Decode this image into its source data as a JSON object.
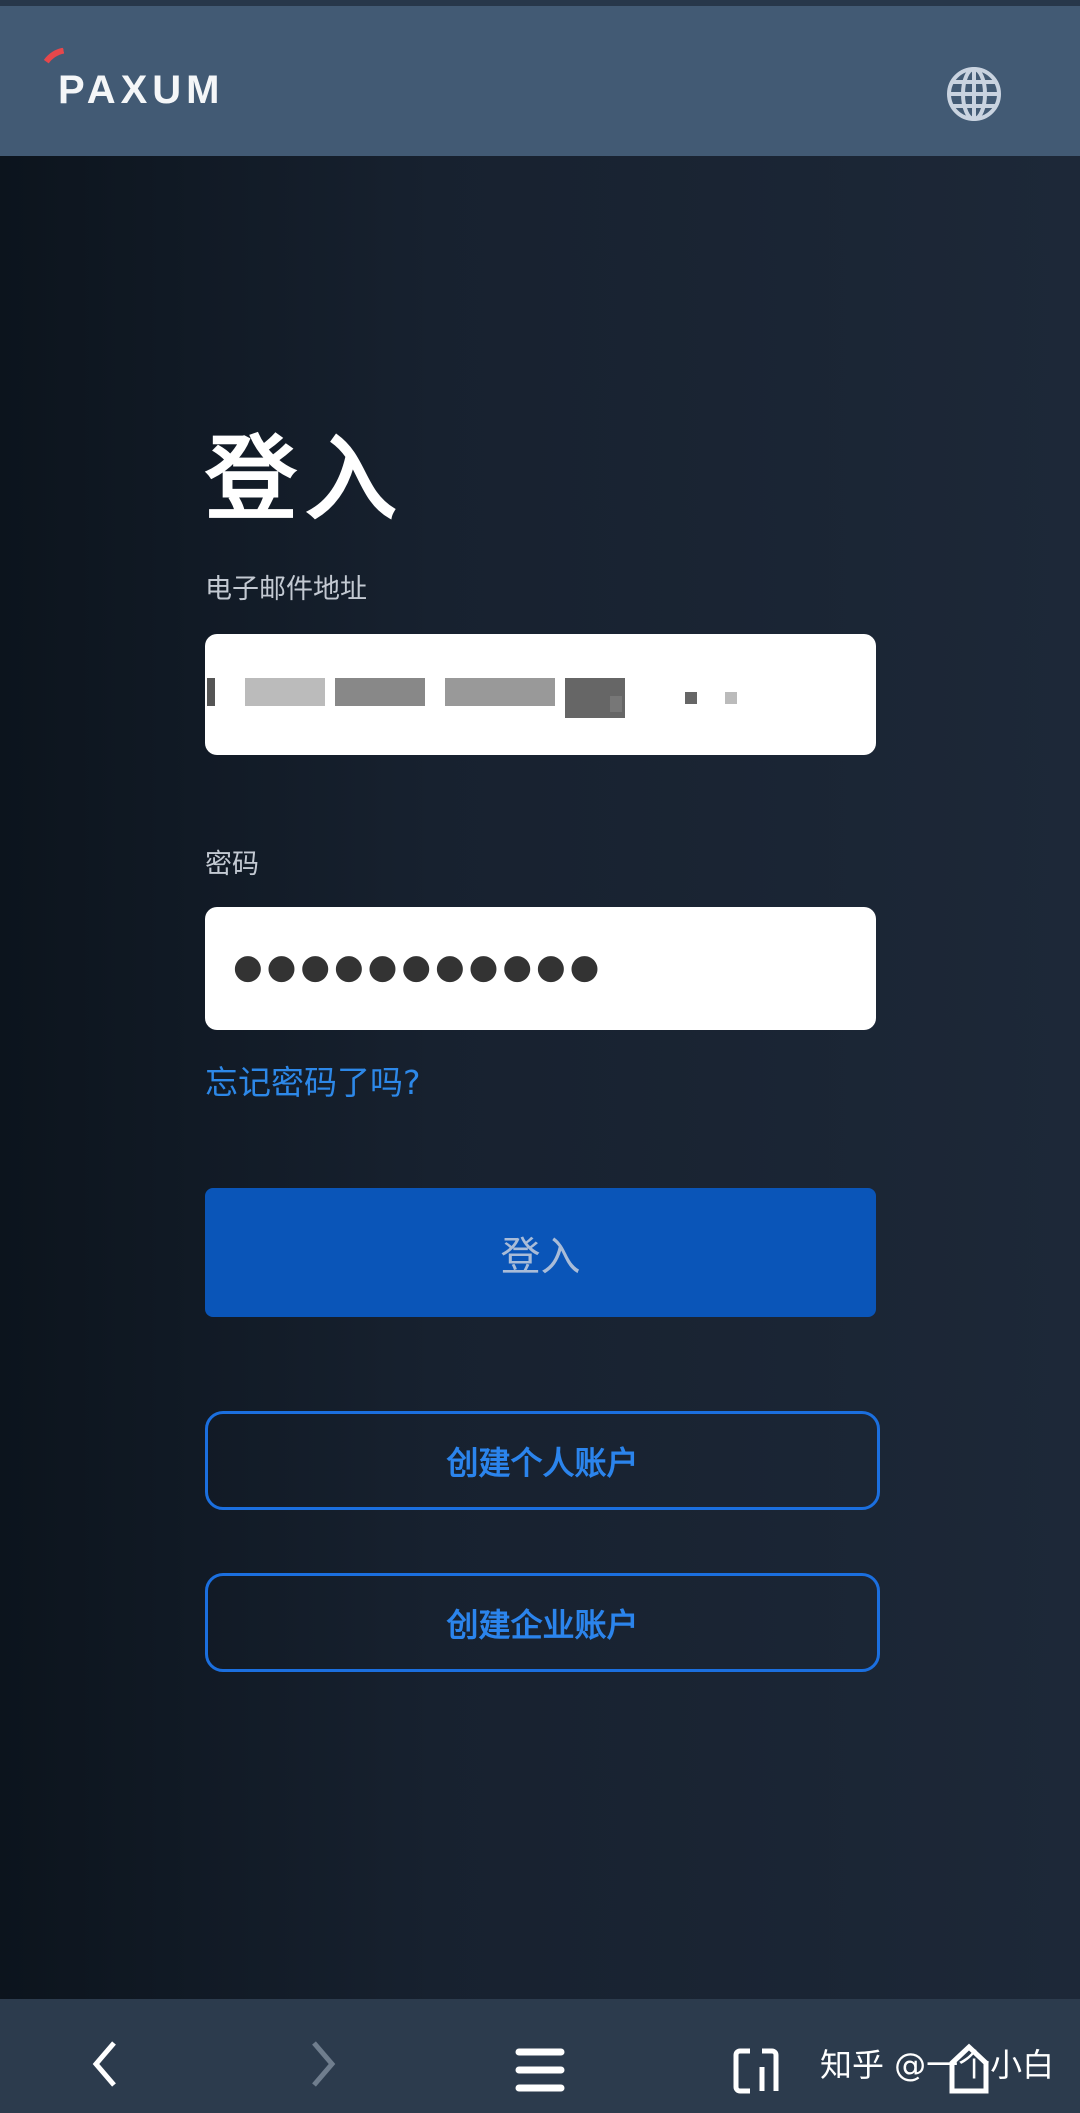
{
  "header": {
    "brand": "PAXUM",
    "language_icon": "globe-icon"
  },
  "login": {
    "title": "登入",
    "email_label": "电子邮件地址",
    "password_label": "密码",
    "password_value": "●●●●●●●●●●●",
    "forgot_link": "忘记密码了吗?",
    "submit_label": "登入",
    "create_personal": "创建个人账户",
    "create_business": "创建企业账户"
  },
  "browser_bar": {
    "icons": [
      "back-icon",
      "forward-icon",
      "menu-icon",
      "tabs-icon",
      "home-icon"
    ],
    "watermark": "知乎 @一个小白"
  },
  "colors": {
    "header": "#425a74",
    "accent": "#0a55b8",
    "link": "#2d88e8",
    "logo_arc": "#e6474b"
  }
}
